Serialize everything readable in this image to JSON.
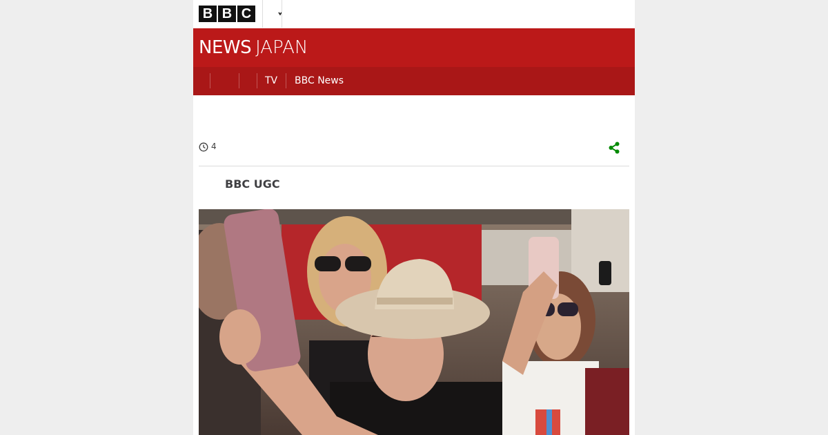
{
  "brand": {
    "letters": [
      "B",
      "B",
      "C"
    ]
  },
  "masthead": {
    "title_main": "NEWS",
    "title_sub": "JAPAN"
  },
  "nav": {
    "items": [
      "TV",
      "BBC News"
    ]
  },
  "article": {
    "read_count": "4",
    "byline": "BBC UGC"
  },
  "icons": {
    "clock": "clock-icon",
    "share": "share-icon",
    "chevron": "chevron-down-icon"
  },
  "colors": {
    "masthead": "#bb1919",
    "navbar": "#a91717",
    "share": "#008a00"
  }
}
